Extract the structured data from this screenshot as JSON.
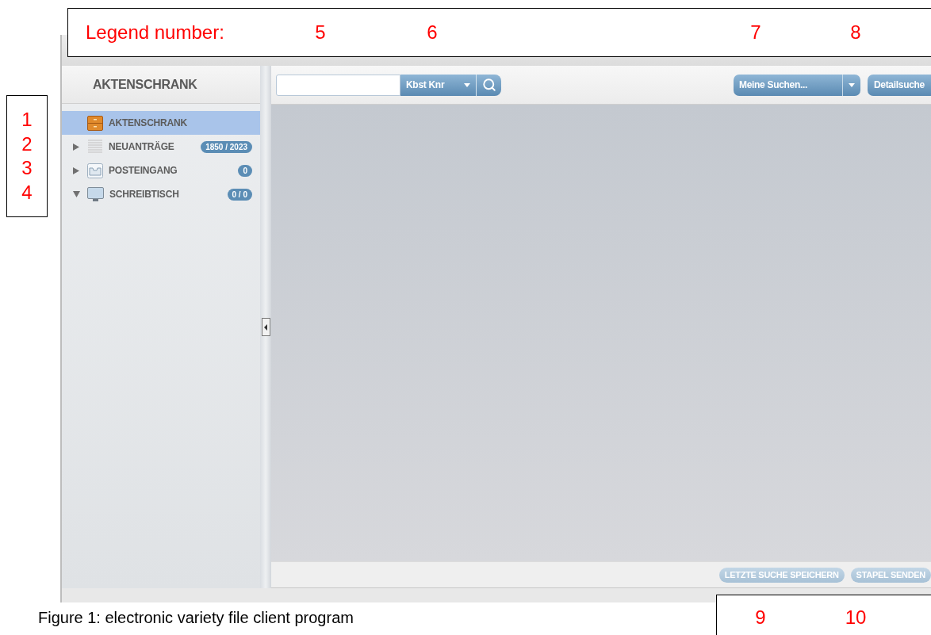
{
  "legend_top": {
    "label": "Legend number:",
    "numbers": [
      "5",
      "6",
      "7",
      "8"
    ]
  },
  "legend_left": {
    "numbers": [
      "1",
      "2",
      "3",
      "4"
    ]
  },
  "sidebar": {
    "title": "AKTENSCHRANK",
    "items": [
      {
        "kind": "cabinet",
        "label": "AKTENSCHRANK",
        "has_children": false,
        "selected": true
      },
      {
        "kind": "list",
        "label": "NEUANTRÄGE",
        "has_children": true,
        "expanded": false,
        "selected": false,
        "badge": "1850 / 2023"
      },
      {
        "kind": "inbox",
        "label": "POSTEINGANG",
        "has_children": true,
        "expanded": false,
        "selected": false,
        "badge": "0"
      },
      {
        "kind": "desk",
        "label": "SCHREIBTISCH",
        "has_children": true,
        "expanded": true,
        "selected": false,
        "badge": "0 / 0"
      }
    ]
  },
  "toolbar": {
    "scope": "Kbst Knr",
    "saved_searches": "Meine Suchen...",
    "detail_button": "Detailsuche"
  },
  "bottom_bar": {
    "buttons": [
      {
        "label": "LETZTE SUCHE SPEICHERN",
        "disabled": true
      },
      {
        "label": "STAPEL SENDEN",
        "disabled": true
      }
    ]
  },
  "legend_bottom": {
    "numbers": [
      "9",
      "10"
    ]
  },
  "caption": "Figure 1: electronic variety file client program"
}
